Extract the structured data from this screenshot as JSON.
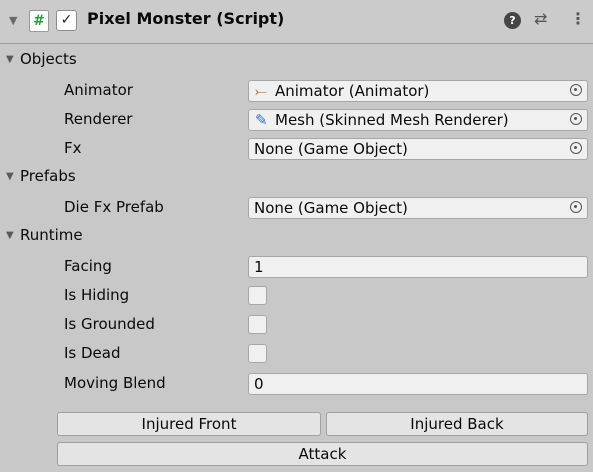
{
  "header": {
    "fold_glyph": "▼",
    "script_icon": "#",
    "check_glyph": "✓",
    "title": "Pixel Monster (Script)",
    "help_glyph": "?",
    "preset_glyph": "⇄",
    "menu_glyph": "⋮"
  },
  "sections": {
    "objects": {
      "label": "Objects",
      "glyph": "▼"
    },
    "prefabs": {
      "label": "Prefabs",
      "glyph": "▼"
    },
    "runtime": {
      "label": "Runtime",
      "glyph": "▼"
    }
  },
  "fields": {
    "animator": {
      "label": "Animator",
      "value": "Animator (Animator)",
      "icon": "⤚"
    },
    "renderer": {
      "label": "Renderer",
      "value": "Mesh (Skinned Mesh Renderer)",
      "icon": "✎"
    },
    "fx": {
      "label": "Fx",
      "value": "None (Game Object)"
    },
    "die_fx_prefab": {
      "label": "Die Fx Prefab",
      "value": "None (Game Object)"
    },
    "facing": {
      "label": "Facing",
      "value": "1"
    },
    "is_hiding": {
      "label": "Is Hiding",
      "checked": false
    },
    "is_grounded": {
      "label": "Is Grounded",
      "checked": false
    },
    "is_dead": {
      "label": "Is Dead",
      "checked": false
    },
    "moving_blend": {
      "label": "Moving Blend",
      "value": "0"
    }
  },
  "buttons": {
    "injured_front": "Injured Front",
    "injured_back": "Injured Back",
    "attack": "Attack"
  }
}
